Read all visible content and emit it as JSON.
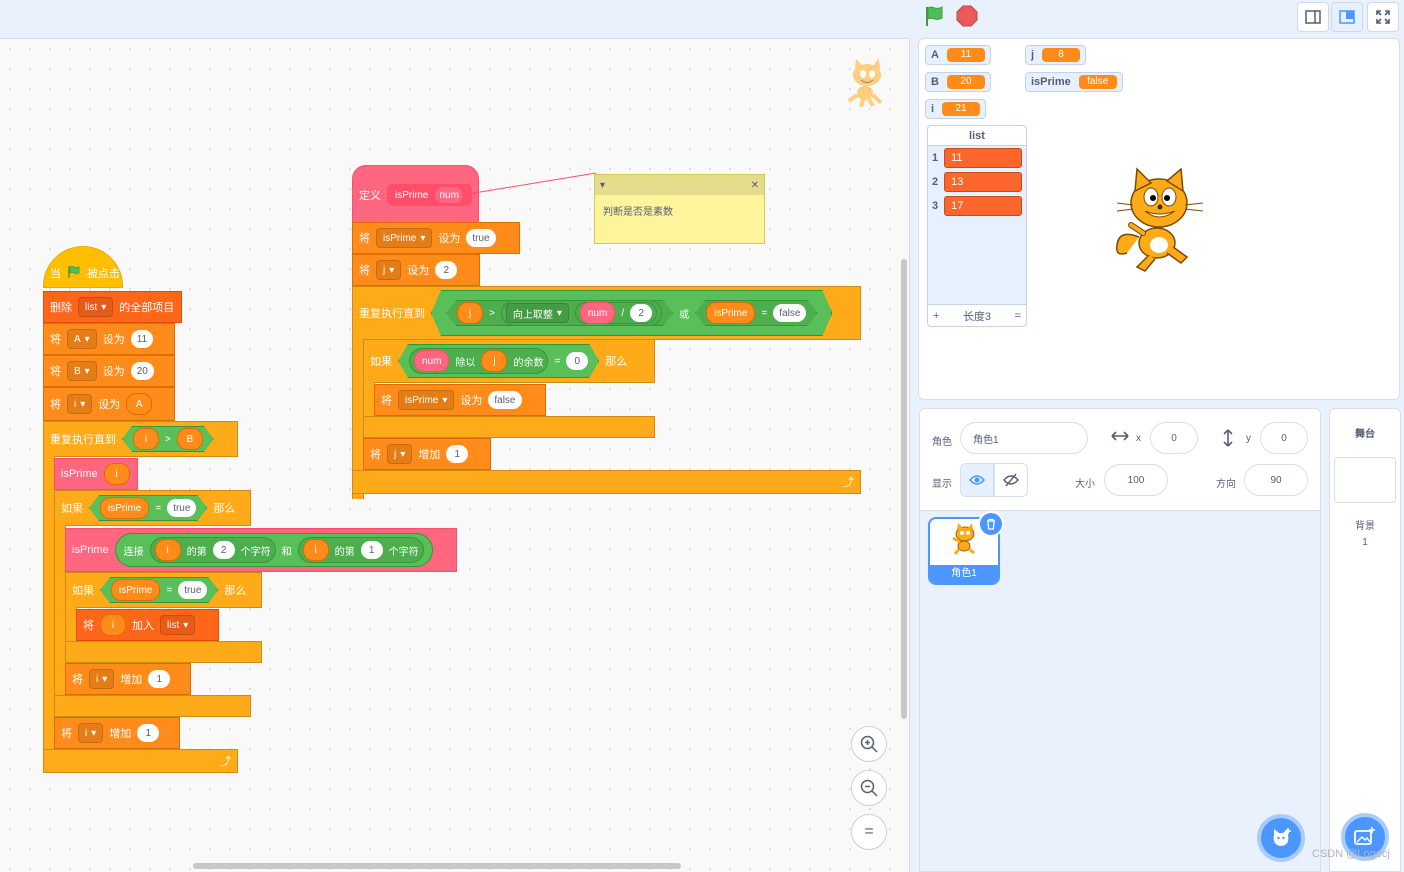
{
  "code": {
    "define_label": "定义",
    "define_name": "isPrime",
    "define_param": "num",
    "comment_text": "判断是否是素数",
    "set_label": "将",
    "to_label": "设为",
    "change_label": "增加",
    "repeat_until_label": "重复执行直到",
    "if_label": "如果",
    "then_label": "那么",
    "var_isPrime": "isPrime",
    "var_j": "j",
    "var_i": "i",
    "var_A": "A",
    "var_B": "B",
    "val_true": "true",
    "val_false": "false",
    "val_2": "2",
    "val_0": "0",
    "val_1": "1",
    "val_11": "11",
    "val_20": "20",
    "gt": ">",
    "eq": "=",
    "div": "/",
    "or_label": "或",
    "round_up": "向上取整",
    "mod_label": "除以",
    "mod_suffix": "的余数",
    "num": "num",
    "when_label": "当",
    "clicked_label": "被点击",
    "delete_label": "删除",
    "list_name": "list",
    "all_items": "的全部项目",
    "join_label": "连接",
    "letter_of": "的第",
    "letter_suffix": "个字符",
    "and_label": "和",
    "add_label": "加入",
    "var_A_reporter": "A",
    "var_B_reporter": "B"
  },
  "stage": {
    "monitors": [
      {
        "name": "A",
        "value": "11"
      },
      {
        "name": "B",
        "value": "20"
      },
      {
        "name": "i",
        "value": "21"
      },
      {
        "name": "j",
        "value": "8"
      },
      {
        "name": "isPrime",
        "value": "false"
      }
    ],
    "list_monitor": {
      "title": "list",
      "items": [
        {
          "index": "1",
          "value": "11"
        },
        {
          "index": "2",
          "value": "13"
        },
        {
          "index": "3",
          "value": "17"
        }
      ],
      "add": "+",
      "length": "长度3",
      "resize": "="
    }
  },
  "sprite_info": {
    "sprite_label": "角色",
    "sprite_name": "角色1",
    "x_label": "x",
    "x_value": "0",
    "y_label": "y",
    "y_value": "0",
    "show_label": "显示",
    "size_label": "大小",
    "size_value": "100",
    "direction_label": "方向",
    "direction_value": "90",
    "tile_name": "角色1"
  },
  "backdrop": {
    "stage_label": "舞台",
    "backdrops_label": "背景",
    "backdrop_count": "1"
  },
  "watermark": "CSDN @Logecj",
  "zoom": {
    "in": "+",
    "out": "−",
    "reset": "="
  }
}
